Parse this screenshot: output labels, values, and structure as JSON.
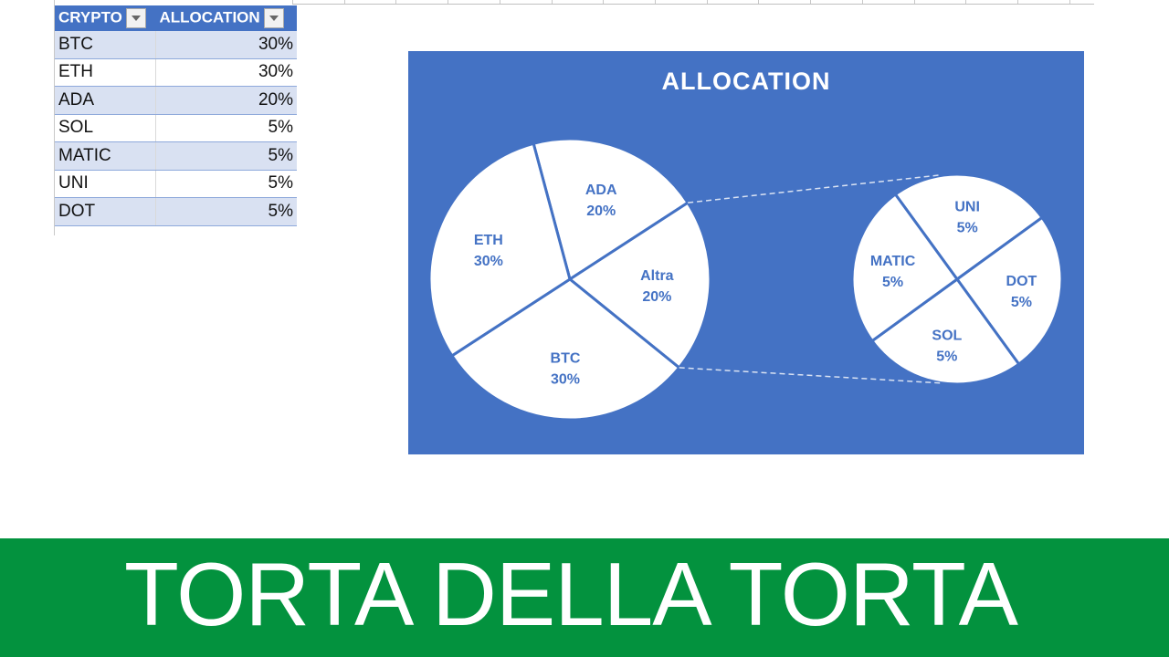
{
  "table": {
    "headers": [
      {
        "label": "CRYPTO"
      },
      {
        "label": "ALLOCATION"
      }
    ],
    "rows": [
      {
        "name": "BTC",
        "value": "30%"
      },
      {
        "name": "ETH",
        "value": "30%"
      },
      {
        "name": "ADA",
        "value": "20%"
      },
      {
        "name": "SOL",
        "value": "5%"
      },
      {
        "name": "MATIC",
        "value": "5%"
      },
      {
        "name": "UNI",
        "value": "5%"
      },
      {
        "name": "DOT",
        "value": "5%"
      }
    ]
  },
  "banner": {
    "text": "TORTA DELLA TORTA",
    "color": "#03923e"
  },
  "colors": {
    "chart_bg": "#4472c4",
    "slice_fill": "#ffffff",
    "label": "#4472c4"
  },
  "chart_data": {
    "type": "pie",
    "subtype": "pie-of-pie",
    "title": "ALLOCATION",
    "main_pie": [
      {
        "label": "ADA",
        "value": 20,
        "display": "20%"
      },
      {
        "label": "Altra",
        "value": 20,
        "display": "20%"
      },
      {
        "label": "BTC",
        "value": 30,
        "display": "30%"
      },
      {
        "label": "ETH",
        "value": 30,
        "display": "30%"
      }
    ],
    "secondary_pie": [
      {
        "label": "UNI",
        "value": 5,
        "display": "5%"
      },
      {
        "label": "DOT",
        "value": 5,
        "display": "5%"
      },
      {
        "label": "SOL",
        "value": 5,
        "display": "5%"
      },
      {
        "label": "MATIC",
        "value": 5,
        "display": "5%"
      }
    ],
    "other_label": "Altra",
    "legend": "none"
  }
}
